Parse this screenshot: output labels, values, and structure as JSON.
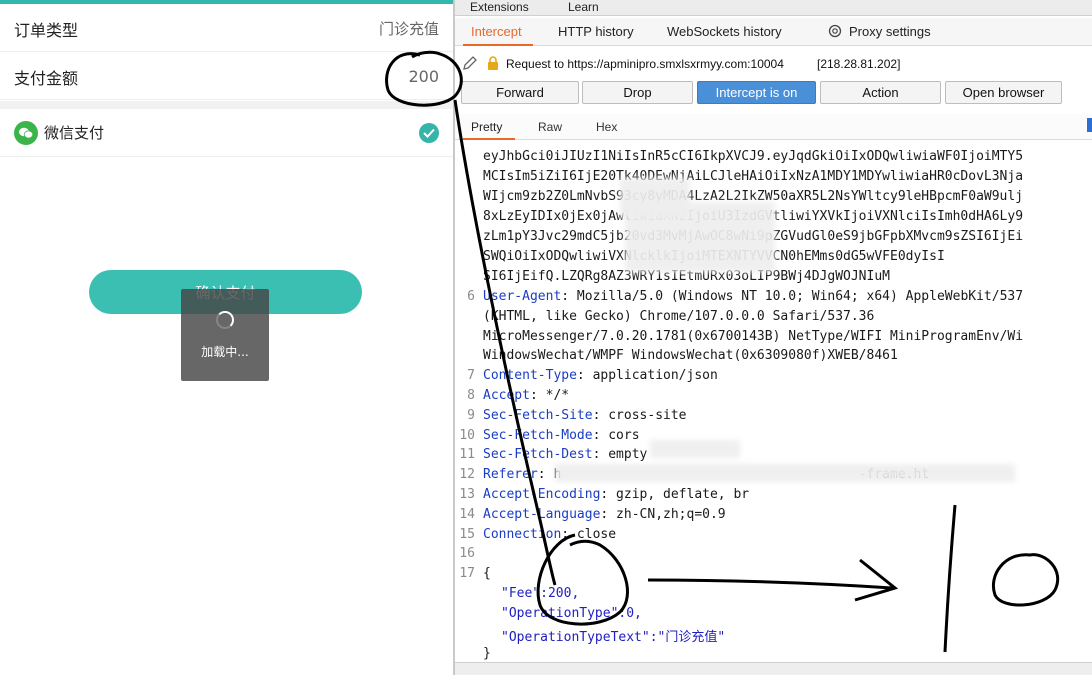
{
  "mini": {
    "order_type_label": "订单类型",
    "order_type_value": "门诊充值",
    "amount_label": "支付金额",
    "amount_value": "200",
    "pay_method_label": "微信支付",
    "confirm_button": "确认支付",
    "loading_text": "加载中..."
  },
  "burp": {
    "menu": [
      "Extensions",
      "Learn"
    ],
    "tabs": [
      "Intercept",
      "HTTP history",
      "WebSockets history",
      "Proxy settings"
    ],
    "request_line": "Request to https://apminipro.smxlsxrmyy.com:10004",
    "request_ip": "[218.28.81.202]",
    "buttons": {
      "forward": "Forward",
      "drop": "Drop",
      "intercept": "Intercept is on",
      "action": "Action",
      "open_browser": "Open browser"
    },
    "view_tabs": [
      "Pretty",
      "Raw",
      "Hex"
    ],
    "token_lines": [
      "eyJhbGci0iJIUzI1NiIsInR5cCI6IkpXVCJ9.eyJqdGkiOiIxODQwliwiaWF0IjoiMTY5",
      "MCIsIm5iZiI6IjE20Tk40DEwNjAiLCJleHAiOiIxNzA1MDY1MDYwliwiaHR0cDovL3Nja",
      "WIjcm9zb2Z0LmNvbS93cy8yMDA4LzA2L2IkZW50aXR5L2NsYWltcy9leHBpcmF0aW9ulj",
      "8xLzEyIDIx0jEx0jAwliwiaXNzIjoiU3IzdGVtliwiYXVkIjoiVXNlciIsImh0dHA6Ly9",
      "zLm1pY3Jvc29mdC5jb20vd3MvMjAwOC8wNi9pZGVudGl0eS9jbGFpbXMvcm9sZSI6IjEi",
      "SWQiOiIxODQwliwiVXNlcklkIjoiMTEXNTYVVCN0hEMms0dG5wVFE0dyIsI",
      "SI6IjEifQ.LZQRg8AZ3WRY1sIEtmURx03oLIP9BWj4DJgWOJNIuM"
    ],
    "headers": [
      {
        "n": "6",
        "k": "User-Agent",
        "v": " Mozilla/5.0 (Windows NT 10.0; Win64; x64) AppleWebKit/537"
      },
      {
        "n": "",
        "k": "",
        "v": "(KHTML, like Gecko) Chrome/107.0.0.0 Safari/537.36"
      },
      {
        "n": "",
        "k": "",
        "v": "MicroMessenger/7.0.20.1781(0x6700143B) NetType/WIFI MiniProgramEnv/Wi"
      },
      {
        "n": "",
        "k": "",
        "v": "WindowsWechat/WMPF WindowsWechat(0x6309080f)XWEB/8461"
      },
      {
        "n": "7",
        "k": "Content-Type",
        "v": " application/json"
      },
      {
        "n": "8",
        "k": "Accept",
        "v": " */*"
      },
      {
        "n": "9",
        "k": "Sec-Fetch-Site",
        "v": " cross-site"
      },
      {
        "n": "10",
        "k": "Sec-Fetch-Mode",
        "v": " cors"
      },
      {
        "n": "11",
        "k": "Sec-Fetch-Dest",
        "v": " empty"
      },
      {
        "n": "12",
        "k": "Referer",
        "v": " h                                      -frame.ht"
      },
      {
        "n": "13",
        "k": "Accept-Encoding",
        "v": " gzip, deflate, br"
      },
      {
        "n": "14",
        "k": "Accept-Language",
        "v": " zh-CN,zh;q=0.9"
      },
      {
        "n": "15",
        "k": "Connection",
        "v": " close"
      },
      {
        "n": "16",
        "k": "",
        "v": ""
      },
      {
        "n": "17",
        "k": "",
        "v": "{"
      }
    ],
    "body": {
      "fee_key": "\"Fee\"",
      "fee_val": ":200,",
      "optype_key": "\"OperationType\"",
      "optype_val": ":0,",
      "optypetext_key": "\"OperationTypeText\"",
      "optypetext_val": ":\"门诊充值\"",
      "close": "}"
    }
  },
  "annotation": {
    "handwritten_value": "10"
  },
  "colors": {
    "teal": "#3cbfb3",
    "burp_orange": "#e8692a",
    "burp_blue": "#4a90d9",
    "wechat_green": "#3bb54a"
  }
}
